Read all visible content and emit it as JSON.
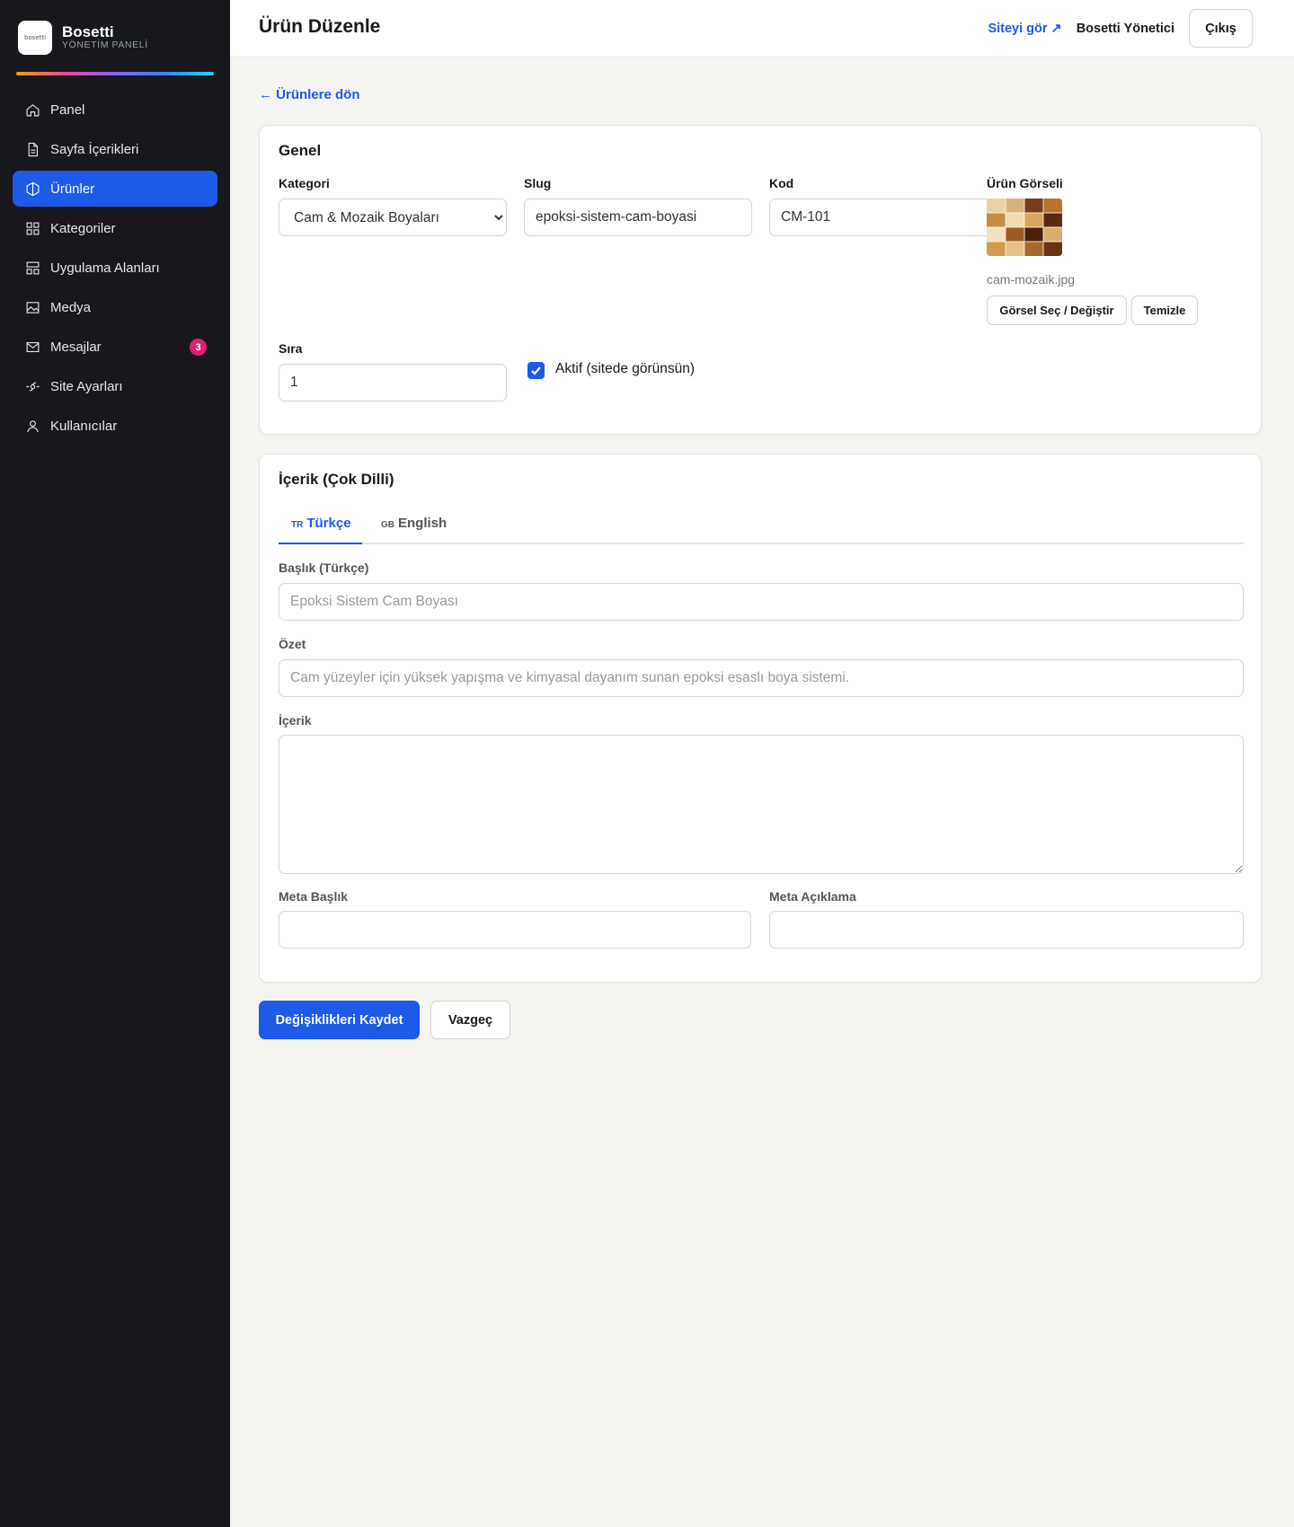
{
  "brand": {
    "name": "Bosetti",
    "subtitle": "YÖNETİM PANELİ",
    "logo_text": "bosetti"
  },
  "sidebar": {
    "items": [
      {
        "label": "Panel",
        "icon": "home-icon",
        "active": false
      },
      {
        "label": "Sayfa İçerikleri",
        "icon": "document-icon",
        "active": false
      },
      {
        "label": "Ürünler",
        "icon": "box-icon",
        "active": true
      },
      {
        "label": "Kategoriler",
        "icon": "grid-icon",
        "active": false
      },
      {
        "label": "Uygulama Alanları",
        "icon": "layout-icon",
        "active": false
      },
      {
        "label": "Medya",
        "icon": "image-icon",
        "active": false
      },
      {
        "label": "Mesajlar",
        "icon": "mail-icon",
        "active": false,
        "badge": "3"
      },
      {
        "label": "Site Ayarları",
        "icon": "settings-icon",
        "active": false
      },
      {
        "label": "Kullanıcılar",
        "icon": "user-icon",
        "active": false
      }
    ]
  },
  "topbar": {
    "title": "Ürün Düzenle",
    "view_site": "Siteyi gör ↗",
    "user": "Bosetti Yönetici",
    "logout": "Çıkış"
  },
  "back_link": "← Ürünlere dön",
  "general": {
    "title": "Genel",
    "category_label": "Kategori",
    "category_value": "Cam & Mozaik Boyaları",
    "slug_label": "Slug",
    "slug_value": "epoksi-sistem-cam-boyasi",
    "code_label": "Kod",
    "code_value": "CM-101",
    "image_label": "Ürün Görseli",
    "image_filename": "cam-mozaik.jpg",
    "choose_image": "Görsel Seç / Değiştir",
    "clear_image": "Temizle",
    "order_label": "Sıra",
    "order_value": "1",
    "active_label": "Aktif (sitede görünsün)",
    "active_checked": true
  },
  "content": {
    "title": "İçerik (Çok Dilli)",
    "tabs": [
      {
        "flag": "TR",
        "label": "Türkçe",
        "active": true
      },
      {
        "flag": "GB",
        "label": "English",
        "active": false
      }
    ],
    "title_label": "Başlık (Türkçe)",
    "title_placeholder": "Epoksi Sistem Cam Boyası",
    "summary_label": "Özet",
    "summary_placeholder": "Cam yüzeyler için yüksek yapışma ve kimyasal dayanım sunan epoksi esaslı boya sistemi.",
    "body_label": "İçerik",
    "meta_title_label": "Meta Başlık",
    "meta_desc_label": "Meta Açıklama"
  },
  "actions": {
    "save": "Değişiklikleri Kaydet",
    "cancel": "Vazgeç"
  },
  "colors": {
    "accent": "#1d5ae8",
    "sidebar_bg": "#17181c",
    "badge": "#e11d74",
    "page_bg": "#f4f4f1"
  }
}
